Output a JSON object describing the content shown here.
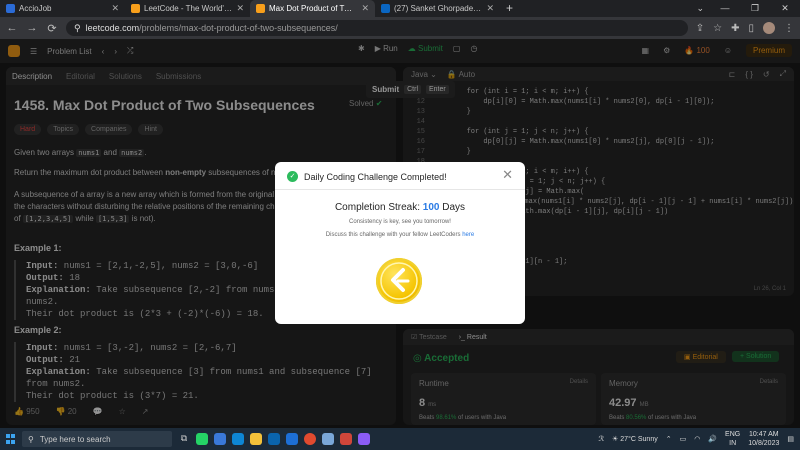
{
  "browser": {
    "tabs": [
      {
        "title": "AccioJob",
        "color": "#2b6bd6",
        "active": false
      },
      {
        "title": "LeetCode - The World's Leading",
        "color": "#f89f1b",
        "active": false
      },
      {
        "title": "Max Dot Product of Two Subseq",
        "color": "#f89f1b",
        "active": true
      },
      {
        "title": "(27) Sanket Ghorpade | LinkedIn",
        "color": "#0a66c2",
        "active": false
      }
    ],
    "new_tab": "+",
    "url_host": "leetcode.com",
    "url_path": "/problems/max-dot-product-of-two-subsequences/"
  },
  "lc": {
    "nav_problem_list": "Problem List",
    "run": "Run",
    "submit": "Submit",
    "streak": "100",
    "premium": "Premium",
    "tooltip": {
      "label": "Submit",
      "k1": "Ctrl",
      "k2": "Enter"
    }
  },
  "left": {
    "tabs": [
      "Description",
      "Editorial",
      "Solutions",
      "Submissions"
    ],
    "title": "1458. Max Dot Product of Two Subsequences",
    "solved": "Solved",
    "chips": [
      "Hard",
      "Topics",
      "Companies",
      "Hint"
    ],
    "p1_a": "Given two arrays ",
    "p1_c1": "nums1",
    "p1_b": " and ",
    "p1_c2": "nums2",
    "p1_d": ".",
    "p2_a": "Return the maximum dot product between ",
    "p2_b": "non-empty",
    "p2_c": " subsequences of nums1 a",
    "p3_line1": "A subsequence of a array is a new array which is formed from the original array by",
    "p3_line2": "the characters without disturbing the relative positions of the remaining character",
    "p3_line3a": "of ",
    "p3_c1": "[1,2,3,4,5]",
    "p3_line3b": " while ",
    "p3_c2": "[1,5,3]",
    "p3_line3c": " is not).",
    "ex1": {
      "head": "Example 1:",
      "input_lbl": "Input:",
      "input": " nums1 = [2,1,-2,5], nums2 = [3,0,-6]",
      "output_lbl": "Output:",
      "output": " 18",
      "exp_lbl": "Explanation:",
      "exp1": " Take subsequence [2,-2] from nums1 and subsequ",
      "exp2": "nums2.",
      "exp3": "Their dot product is (2*3 + (-2)*(-6)) = 18."
    },
    "ex2": {
      "head": "Example 2:",
      "input_lbl": "Input:",
      "input": " nums1 = [3,-2], nums2 = [2,-6,7]",
      "output_lbl": "Output:",
      "output": " 21",
      "exp_lbl": "Explanation:",
      "exp1": " Take subsequence [3] from nums1 and subsequence [7] from nums2.",
      "exp2": "Their dot product is (3*7) = 21."
    },
    "likes": "950",
    "dislikes": "20"
  },
  "editor": {
    "lang": "Java",
    "auto": "Auto",
    "lines": [
      {
        "n": "11",
        "code": "        for (int i = 1; i < m; i++) {"
      },
      {
        "n": "12",
        "code": "            dp[i][0] = Math.max(nums1[i] * nums2[0], dp[i - 1][0]);"
      },
      {
        "n": "13",
        "code": "        }"
      },
      {
        "n": "14",
        "code": ""
      },
      {
        "n": "15",
        "code": "        for (int j = 1; j < n; j++) {"
      },
      {
        "n": "16",
        "code": "            dp[0][j] = Math.max(nums1[0] * nums2[j], dp[0][j - 1]);"
      },
      {
        "n": "17",
        "code": "        }"
      },
      {
        "n": "18",
        "code": ""
      },
      {
        "n": "19",
        "code": "        for (int i = 1; i < m; i++) {"
      },
      {
        "n": "20",
        "code": "            for (int j = 1; j < n; j++) {"
      },
      {
        "n": "21",
        "code": "                dp[i][j] = Math.max("
      },
      {
        "n": "22",
        "code": "                    Math.max(nums1[i] * nums2[j], dp[i - 1][j - 1] + nums1[i] * nums2[j]),"
      },
      {
        "n": "23",
        "code": "                    Math.max(dp[i - 1][j], dp[i][j - 1])"
      },
      {
        "n": "24",
        "code": "                );"
      },
      {
        "n": "25",
        "code": "            }"
      },
      {
        "n": "26",
        "code": "        }"
      },
      {
        "n": "27",
        "code": ""
      },
      {
        "n": "28",
        "code": "        return dp[m - 1][n - 1];"
      }
    ],
    "status": "Ln 26, Col 1"
  },
  "result": {
    "tab1": "Testcase",
    "tab2": "Result",
    "accepted": "Accepted",
    "editorial": "Editorial",
    "solution": "+ Solution",
    "runtime_lbl": "Runtime",
    "runtime_val": "8",
    "runtime_unit": "ms",
    "runtime_beats": "98.61%",
    "memory_lbl": "Memory",
    "memory_val": "42.97",
    "memory_unit": "MB",
    "memory_beats": "80.56%",
    "details": "Details",
    "beats_pre": "Beats ",
    "beats_post": " of users with Java"
  },
  "modal": {
    "title": "Daily Coding Challenge Completed!",
    "close": "✕",
    "streak_pre": "Completion Streak: ",
    "streak_num": "100",
    "streak_post": " Days",
    "sub1": "Consistency is key, see you tomorrow!",
    "sub2": "Discuss this challenge with your fellow LeetCoders ",
    "sub2_link": "here"
  },
  "taskbar": {
    "search": "Type here to search",
    "weather": "27°C Sunny",
    "lang1": "ENG",
    "lang2": "IN",
    "time": "10:47 AM",
    "date": "10/8/2023"
  }
}
